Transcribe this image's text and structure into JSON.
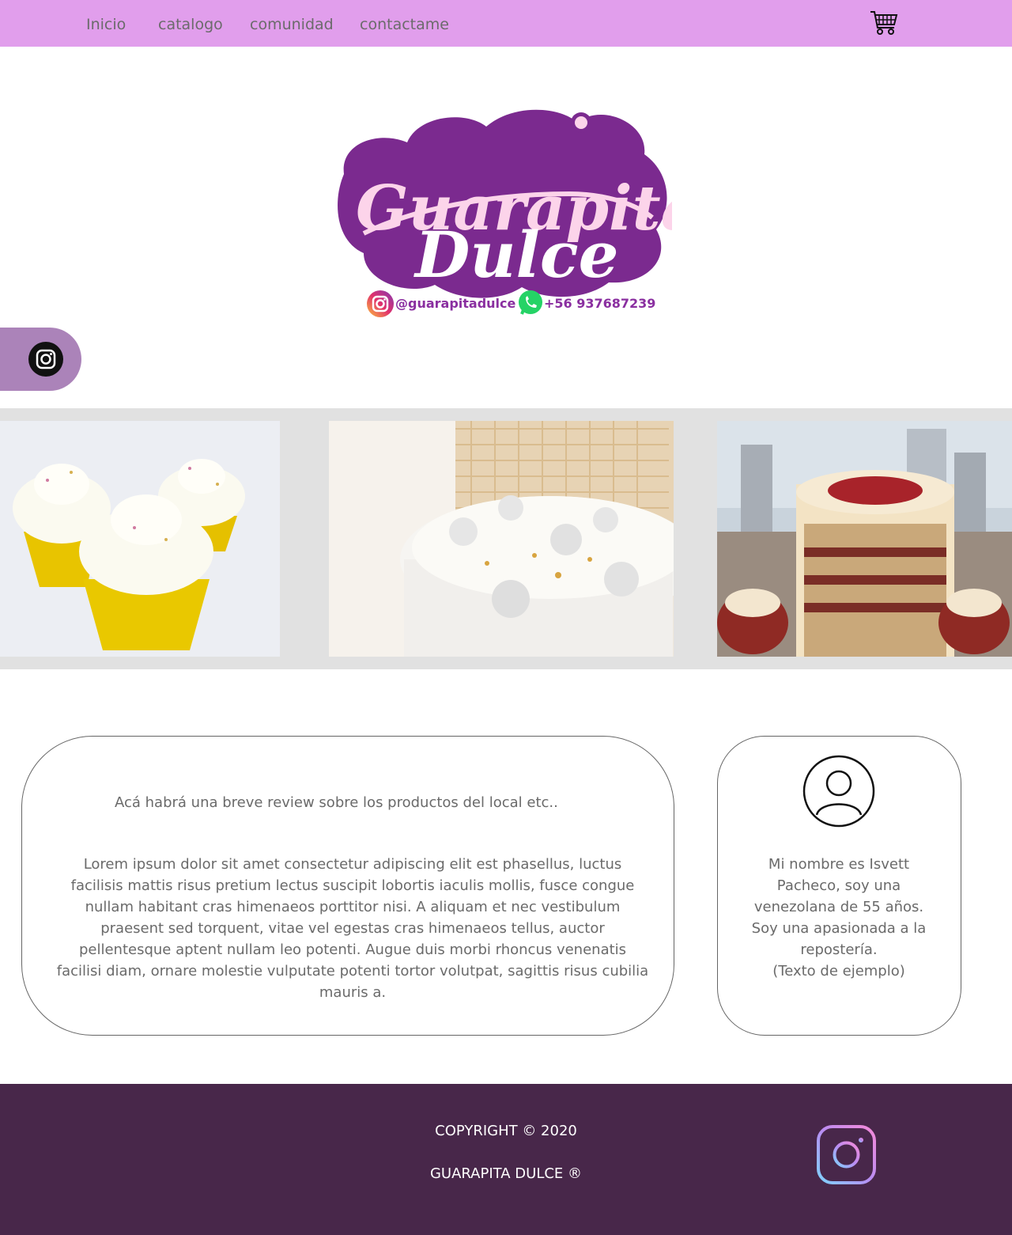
{
  "nav": {
    "links": [
      "Inicio",
      "catalogo",
      "comunidad",
      "contactame"
    ]
  },
  "hero": {
    "logo_line1": "Guarapita",
    "logo_line2": "Dulce",
    "instagram_handle": "@guarapitadulce",
    "phone": "+56 937687239"
  },
  "review": {
    "title": "Acá habrá una breve review sobre los productos del local etc..",
    "body": "Lorem ipsum dolor sit amet consectetur adipiscing elit est phasellus, luctus facilisis mattis risus pretium lectus suscipit lobortis iaculis mollis, fusce congue nullam habitant cras himenaeos porttitor nisi. A aliquam et nec vestibulum praesent sed torquent, vitae vel egestas cras himenaeos tellus, auctor pellentesque aptent nullam leo potenti. Augue duis morbi rhoncus venenatis facilisi diam, ornare molestie vulputate potenti tortor volutpat, sagittis risus cubilia mauris a."
  },
  "bio": {
    "text": "Mi nombre es Isvett Pacheco, soy una venezolana de 55 años. Soy una apasionada a la repostería.",
    "note": "(Texto de ejemplo)"
  },
  "footer": {
    "copyright": "COPYRIGHT © 2020",
    "brand": "GUARAPITA DULCE ®"
  },
  "colors": {
    "nav_bg": "#e19eec",
    "pill_bg": "#ab83b9",
    "footer_bg": "#48274a",
    "brand_purple": "#7b2a8f",
    "brand_pink": "#fcd4ea"
  },
  "icons": [
    "cart-icon",
    "instagram-icon",
    "whatsapp-icon",
    "user-avatar-icon"
  ]
}
